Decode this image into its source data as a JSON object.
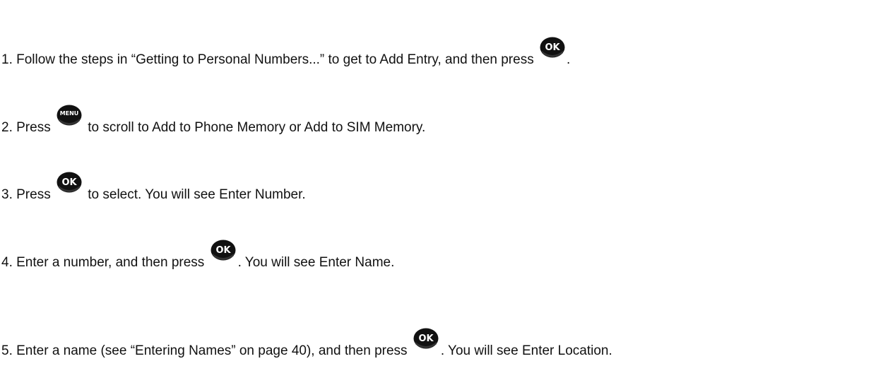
{
  "steps": [
    {
      "before": "1. Follow the steps in “Getting to Personal Numbers...” to get to Add Entry, and then press",
      "key": "ok-key-icon",
      "key_label": "OK",
      "after": "."
    },
    {
      "before": "2. Press",
      "key": "menu-key-icon",
      "key_label": "MENU",
      "after": " to scroll to Add to Phone Memory or Add to SIM Memory."
    },
    {
      "before": "3. Press",
      "key": "ok-key-icon",
      "key_label": "OK",
      "after": " to select. You will see Enter Number."
    },
    {
      "before": "4. Enter a number, and then press",
      "key": "ok-key-icon",
      "key_label": "OK",
      "after": ". You will see Enter Name."
    },
    {
      "before": "5. Enter a name (see “Entering Names” on page 40), and then press",
      "key": "ok-key-icon",
      "key_label": "OK",
      "after": ". You will see Enter Location."
    }
  ],
  "colors": {
    "key_fill": "#111111",
    "key_text": "#ffffff"
  }
}
